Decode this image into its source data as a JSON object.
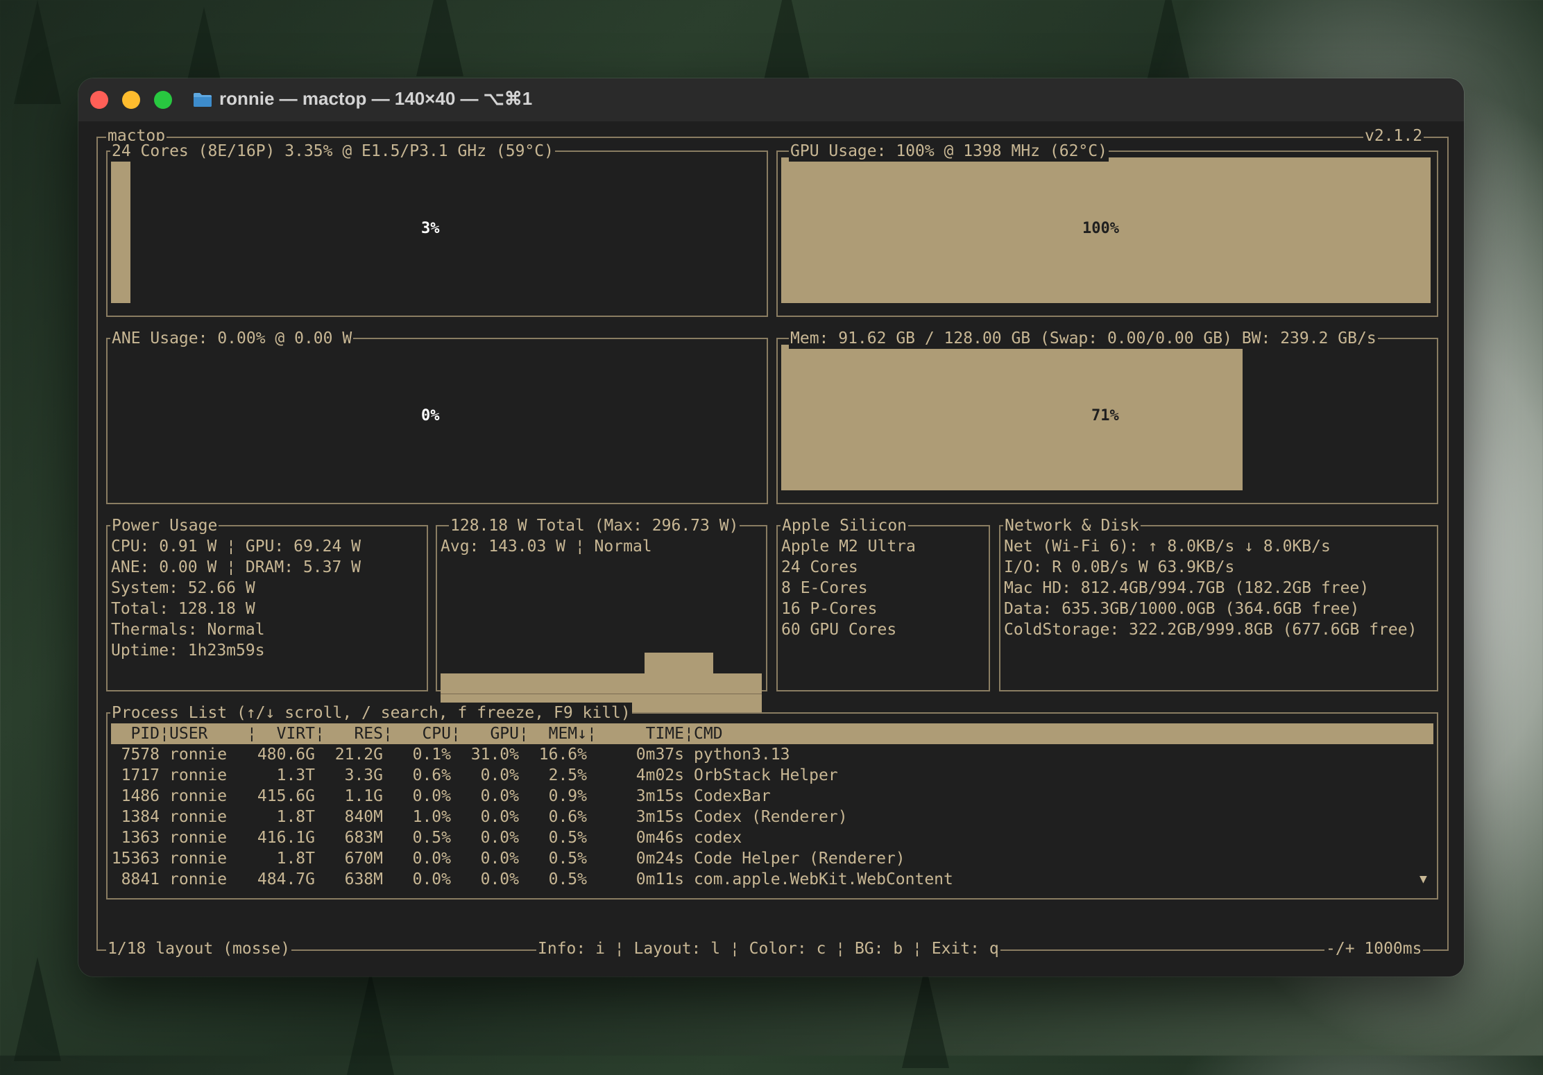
{
  "window": {
    "title": "ronnie — mactop — 140×40 — ⌥⌘1"
  },
  "app": {
    "name": "mactop",
    "version": "v2.1.2"
  },
  "cpu": {
    "title": "24 Cores (8E/16P) 3.35% @ E1.5/P3.1 GHz (59°C)",
    "percent": 3,
    "percent_label": "3%"
  },
  "gpu": {
    "title": "GPU Usage: 100% @ 1398 MHz (62°C)",
    "percent": 100,
    "percent_label": "100%"
  },
  "ane": {
    "title": "ANE Usage: 0.00% @ 0.00 W",
    "percent": 0,
    "percent_label": "0%"
  },
  "mem": {
    "title": "Mem: 91.62 GB / 128.00 GB (Swap: 0.00/0.00 GB) BW: 239.2 GB/s",
    "percent": 71,
    "percent_label": "71%"
  },
  "power": {
    "title": "Power Usage",
    "lines": [
      "CPU: 0.91 W ¦ GPU: 69.24 W",
      "ANE: 0.00 W ¦ DRAM: 5.37 W",
      "System: 52.66 W",
      "Total: 128.18 W",
      "Thermals: Normal",
      "Uptime: 1h23m59s"
    ]
  },
  "power_chart": {
    "title": "128.18 W Total (Max: 296.73 W)",
    "avg": "Avg: 143.03 W ¦ Normal"
  },
  "silicon": {
    "title": "Apple Silicon",
    "lines": [
      "Apple M2 Ultra",
      "24 Cores",
      "8 E-Cores",
      "16 P-Cores",
      "60 GPU Cores"
    ]
  },
  "network": {
    "title": "Network & Disk",
    "lines": [
      "Net (Wi-Fi 6): ↑ 8.0KB/s ↓ 8.0KB/s",
      "I/O: R 0.0B/s W 63.9KB/s",
      "Mac HD: 812.4GB/994.7GB (182.2GB free)",
      "Data: 635.3GB/1000.0GB (364.6GB free)",
      "ColdStorage: 322.2GB/999.8GB (677.6GB free)"
    ]
  },
  "processes": {
    "title": "Process List (↑/↓ scroll, / search, f freeze, F9 kill)",
    "headers": {
      "pid": "PID",
      "user": "USER",
      "virt": "VIRT",
      "res": "RES",
      "cpu": "CPU",
      "gpu": "GPU",
      "mem": "MEM↓",
      "time": "TIME",
      "cmd": "CMD"
    },
    "rows": [
      {
        "pid": "7578",
        "user": "ronnie",
        "virt": "480.6G",
        "res": "21.2G",
        "cpu": "0.1%",
        "gpu": "31.0%",
        "mem": "16.6%",
        "time": "0m37s",
        "cmd": "python3.13"
      },
      {
        "pid": "1717",
        "user": "ronnie",
        "virt": "1.3T",
        "res": "3.3G",
        "cpu": "0.6%",
        "gpu": "0.0%",
        "mem": "2.5%",
        "time": "4m02s",
        "cmd": "OrbStack Helper"
      },
      {
        "pid": "1486",
        "user": "ronnie",
        "virt": "415.6G",
        "res": "1.1G",
        "cpu": "0.0%",
        "gpu": "0.0%",
        "mem": "0.9%",
        "time": "3m15s",
        "cmd": "CodexBar"
      },
      {
        "pid": "1384",
        "user": "ronnie",
        "virt": "1.8T",
        "res": "840M",
        "cpu": "1.0%",
        "gpu": "0.0%",
        "mem": "0.6%",
        "time": "3m15s",
        "cmd": "Codex (Renderer)"
      },
      {
        "pid": "1363",
        "user": "ronnie",
        "virt": "416.1G",
        "res": "683M",
        "cpu": "0.5%",
        "gpu": "0.0%",
        "mem": "0.5%",
        "time": "0m46s",
        "cmd": "codex"
      },
      {
        "pid": "15363",
        "user": "ronnie",
        "virt": "1.8T",
        "res": "670M",
        "cpu": "0.0%",
        "gpu": "0.0%",
        "mem": "0.5%",
        "time": "0m24s",
        "cmd": "Code Helper (Renderer)"
      },
      {
        "pid": "8841",
        "user": "ronnie",
        "virt": "484.7G",
        "res": "638M",
        "cpu": "0.0%",
        "gpu": "0.0%",
        "mem": "0.5%",
        "time": "0m11s",
        "cmd": "com.apple.WebKit.WebContent"
      }
    ],
    "scroll_indicator": "▼"
  },
  "footer": {
    "left": "1/18 layout (mosse)",
    "center": "Info: i ¦ Layout: l ¦ Color: c ¦ BG: b ¦ Exit: q",
    "right": "-/+ 1000ms"
  },
  "colors": {
    "accent": "#ae9c76",
    "text": "#c8b794",
    "border": "#8a7d62",
    "background": "#1f1f1f"
  }
}
